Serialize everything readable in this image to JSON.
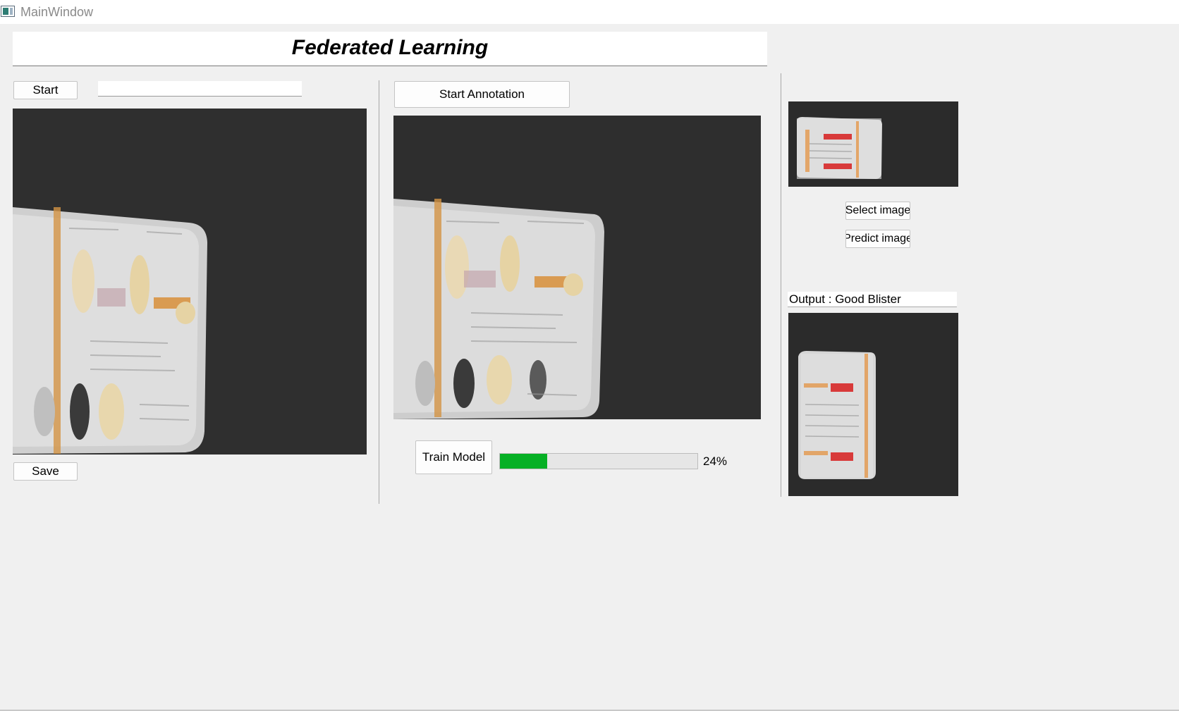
{
  "window": {
    "title": "MainWindow"
  },
  "header": {
    "title": "Federated Learning"
  },
  "left_panel": {
    "start_label": "Start",
    "path_value": "",
    "save_label": "Save"
  },
  "center_panel": {
    "annotation_label": "Start Annotation",
    "train_label": "Train Model",
    "progress_fraction": 0.24,
    "progress_text": "24%"
  },
  "right_panel": {
    "select_label": "Select image",
    "predict_label": "Predict image",
    "output_text": "Output : Good Blister"
  },
  "colors": {
    "progress_fill": "#06b025",
    "background": "#f0f0f0",
    "camera_background": "#2f2f2f"
  },
  "icons": [
    "app-window-icon"
  ]
}
